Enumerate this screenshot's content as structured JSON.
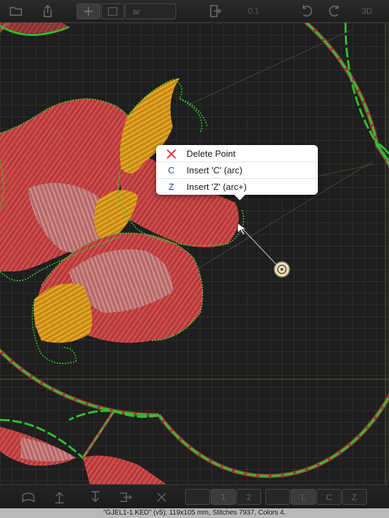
{
  "toolbar_top": {
    "grid_label": "ar",
    "step_value": "0.1",
    "view_3d": "3D"
  },
  "context_menu": {
    "items": [
      {
        "icon": "X",
        "label": "Delete Point"
      },
      {
        "icon": "C",
        "label": "Insert 'C' (arc)"
      },
      {
        "icon": "Z",
        "label": "Insert 'Z' (arc+)"
      }
    ]
  },
  "toolbar_bottom": {
    "page_1": "1",
    "page_2": "2",
    "mode_l": "L",
    "mode_c": "C",
    "mode_z": "Z"
  },
  "status": {
    "text": "\"GJEL1-1.KED\" (v5):   119x105 mm,   Stitches 7937,   Colors 4."
  },
  "colors": {
    "outline_green": "#2fbf2f",
    "stitch_red": "#c24444",
    "stitch_pink": "#c87a7a",
    "stitch_gold": "#d99a1a",
    "menu_red_icon": "#d92020",
    "menu_blue_icon": "#1a3ea8"
  }
}
